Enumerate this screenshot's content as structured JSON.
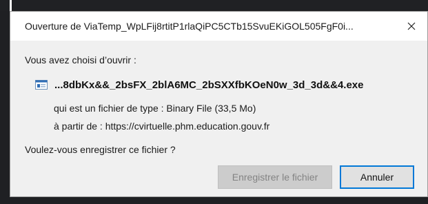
{
  "dialog": {
    "title": "Ouverture de ViaTemp_WpLFij8rtitP1rlaQiPC5CTb15SvuEKiGOL505FgF0i...",
    "close_icon": "close-icon",
    "prompt": "Vous avez choisi d’ouvrir :",
    "file": {
      "icon": "executable-file-icon",
      "name": "...8dbKx&&_2bsFX_2blA6MC_2bSXXfbKOeN0w_3d_3d&&4.exe"
    },
    "type_line": "qui est un fichier de type : Binary File (33,5 Mo)",
    "source_line": "à partir de : https://cvirtuelle.phm.education.gouv.fr",
    "question": "Voulez-vous enregistrer ce fichier ?",
    "buttons": {
      "save_label": "Enregistrer le fichier",
      "save_enabled": false,
      "cancel_label": "Annuler"
    }
  },
  "colors": {
    "dialog_bg": "#f0f0f0",
    "titlebar_bg": "#ffffff",
    "focus_border": "#0078d7",
    "disabled_text": "#838383"
  }
}
